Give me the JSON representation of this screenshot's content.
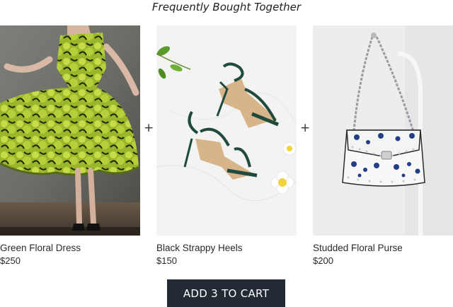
{
  "section": {
    "title": "Frequently Bought Together"
  },
  "products": [
    {
      "name": "Green Floral Dress",
      "price": "$250",
      "image_icon": "green-dress-photo"
    },
    {
      "name": "Black Strappy Heels",
      "price": "$150",
      "image_icon": "strappy-heels-photo"
    },
    {
      "name": "Studded Floral Purse",
      "price": "$200",
      "image_icon": "floral-purse-photo"
    }
  ],
  "separators": [
    "+",
    "+"
  ],
  "cart": {
    "button_label": "ADD 3 TO CART"
  },
  "colors": {
    "button_bg": "#222a34",
    "button_text": "#ffffff",
    "text": "#2a2a2a"
  }
}
